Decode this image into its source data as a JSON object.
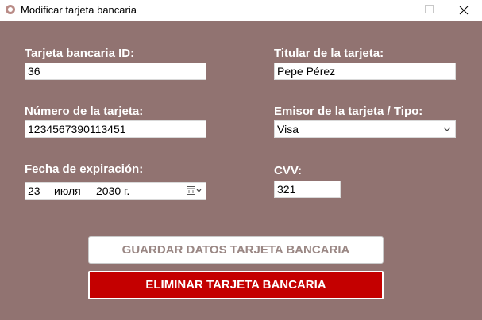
{
  "window": {
    "title": "Modificar tarjeta bancaria",
    "background_color": "#917371"
  },
  "form": {
    "card_id": {
      "label": "Tarjeta bancaria ID:",
      "value": "36"
    },
    "holder": {
      "label": "Titular de la tarjeta:",
      "value": "Pepe Pérez"
    },
    "card_number": {
      "label": "Número de la tarjeta:",
      "value": "1234567390113451"
    },
    "issuer": {
      "label": "Emisor de la tarjeta / Tipo:",
      "selected": "Visa"
    },
    "expiry": {
      "label": "Fecha de expiración:",
      "day": "23",
      "month": "июля",
      "year": "2030 г."
    },
    "cvv": {
      "label": "CVV:",
      "value": "321"
    }
  },
  "buttons": {
    "save_label": "GUARDAR DATOS TARJETA BANCARIA",
    "delete_label": "ELIMINAR TARJETA BANCARIA",
    "delete_color": "#c40000"
  },
  "icons": {
    "app": "app-icon",
    "dropdown": "chevron-down-icon",
    "calendar": "calendar-icon"
  }
}
